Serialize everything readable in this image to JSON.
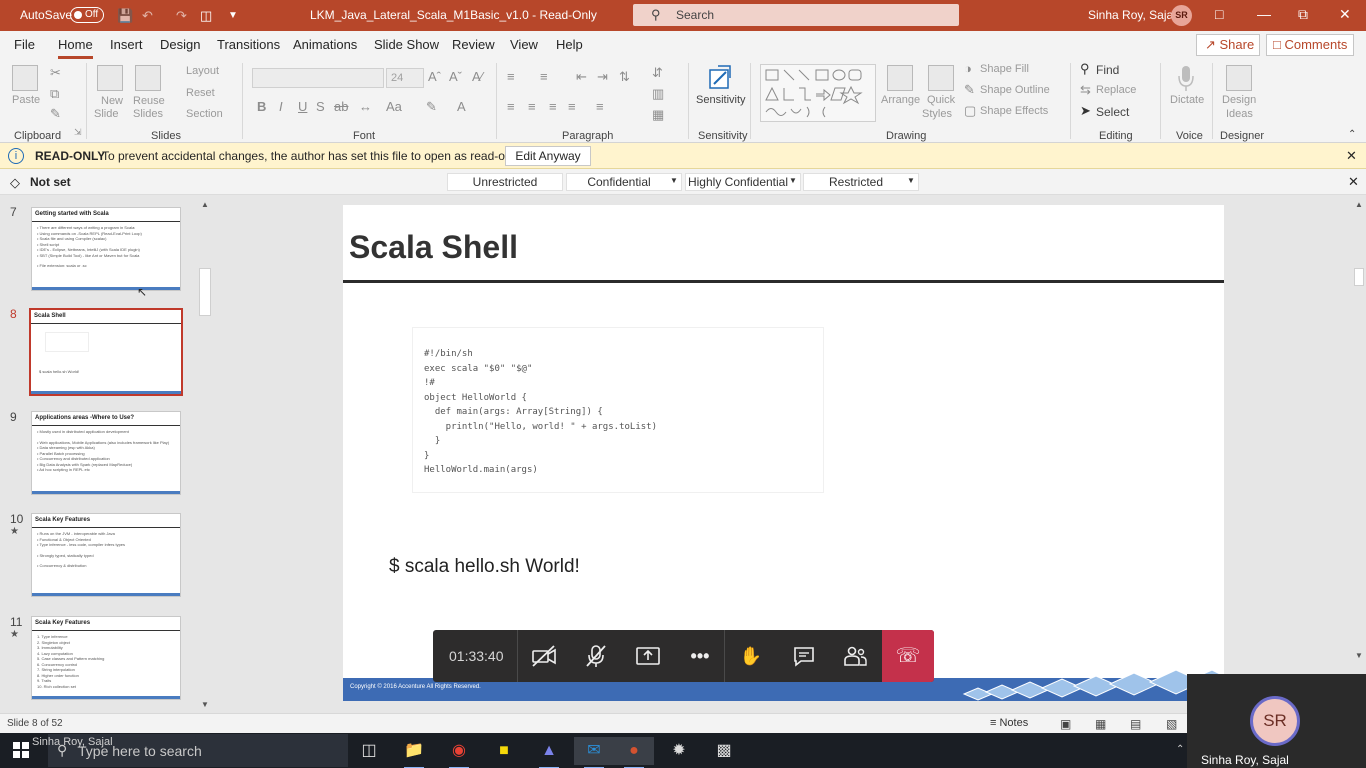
{
  "titlebar": {
    "autosave_label": "AutoSave",
    "autosave_state": "Off",
    "doc_title": "LKM_Java_Lateral_Scala_M1Basic_v1.0  -  Read-Only",
    "search_placeholder": "Search",
    "user_name": "Sinha Roy, Sajal",
    "user_initials": "SR",
    "accent_color": "#b7472a"
  },
  "menu": {
    "tabs": [
      "File",
      "Home",
      "Insert",
      "Design",
      "Transitions",
      "Animations",
      "Slide Show",
      "Review",
      "View",
      "Help"
    ],
    "active_tab": "Home",
    "share_label": "Share",
    "comments_label": "Comments"
  },
  "ribbon": {
    "clipboard": {
      "label": "Clipboard",
      "paste": "Paste"
    },
    "slides": {
      "label": "Slides",
      "new_slide_1": "New",
      "new_slide_2": "Slide",
      "reuse_1": "Reuse",
      "reuse_2": "Slides",
      "layout": "Layout",
      "reset": "Reset",
      "section": "Section"
    },
    "font": {
      "label": "Font",
      "size": "24"
    },
    "paragraph": {
      "label": "Paragraph"
    },
    "sensitivity": {
      "label": "Sensitivity",
      "button": "Sensitivity"
    },
    "drawing": {
      "label": "Drawing",
      "arrange": "Arrange",
      "quick_1": "Quick",
      "quick_2": "Styles",
      "fill": "Shape Fill",
      "outline": "Shape Outline",
      "effects": "Shape Effects"
    },
    "editing": {
      "label": "Editing",
      "find": "Find",
      "replace": "Replace",
      "select": "Select"
    },
    "voice": {
      "label": "Voice",
      "dictate": "Dictate"
    },
    "designer": {
      "label": "Designer",
      "ideas_1": "Design",
      "ideas_2": "Ideas"
    }
  },
  "readonly_bar": {
    "label": "READ-ONLY",
    "message": "To prevent accidental changes, the author has set this file to open as read-only.",
    "button": "Edit Anyway"
  },
  "sensitivity_bar": {
    "status": "Not set",
    "levels": [
      "Unrestricted",
      "Confidential",
      "Highly Confidential",
      "Restricted"
    ]
  },
  "thumbnails": [
    {
      "number": "7",
      "title": "Getting started with Scala",
      "lines": [
        "• There are different ways of writing a program in Scala:",
        "  • Using commands on -Scala REPL (Read-Eval-Print Loop)",
        "  • Scala file and using Compiler (scalac)",
        "  • Shell script",
        "  • IDE's - Eclipse, Netbeans, IntelliJ (with Scala IDE plugin)",
        "  • SBT (Simple Build Tool) - like Ant or Maven but for Scala",
        "",
        "• File extension: scala or .sc"
      ],
      "starred": false,
      "selected": false
    },
    {
      "number": "8",
      "title": "Scala Shell",
      "lines": [],
      "sub": "$ scala hello.sh World!",
      "starred": false,
      "selected": true
    },
    {
      "number": "9",
      "title": "Applications areas -Where to Use?",
      "lines": [
        "• Mostly used in distributed application development",
        "",
        "• Web applications, Mobile Applications (also includes framework like Play)",
        "• Data streaming (esp with Akka)",
        "• Parallel Batch processing",
        "• Concurrency and distributed application",
        "• Big Data Analysis with Spark (replaced MapReduce)",
        "• Ad hoc scripting in REPL etc"
      ],
      "starred": false,
      "selected": false
    },
    {
      "number": "10",
      "title": "Scala Key Features",
      "lines": [
        "• Runs on the JVM - interoperable with Java",
        "• Functional & Object Oriented",
        "• Type inference - less code, compiler infers types",
        "",
        "• Strongly typed, statically typed",
        "",
        "• Concurrency & distribution"
      ],
      "starred": true,
      "selected": false
    },
    {
      "number": "11",
      "title": "Scala Key Features",
      "lines": [
        "1. Type inference",
        "2. Singleton object",
        "3. Immutability",
        "4. Lazy computation",
        "5. Case classes and Pattern matching",
        "6. Concurrency control",
        "7. String interpolation",
        "8. Higher order function",
        "9. Traits",
        "10. Rich collection set"
      ],
      "starred": true,
      "selected": false
    }
  ],
  "slide": {
    "title": "Scala Shell",
    "code": "#!/bin/sh\nexec scala \"$0\" \"$@\"\n!#\nobject HelloWorld {\n  def main(args: Array[String]) {\n    println(\"Hello, world! \" + args.toList)\n  }\n}\nHelloWorld.main(args)",
    "command": "$ scala hello.sh World!",
    "copyright": "Copyright © 2016 Accenture All Rights Reserved."
  },
  "callbar": {
    "duration": "01:33:40"
  },
  "statusbar": {
    "slide_info": "Slide 8 of 52",
    "notes": "Notes"
  },
  "taskbar": {
    "search_placeholder": "Type here to search",
    "ghost_name": "Sinha Roy, Sajal"
  },
  "videotile": {
    "initials": "SR",
    "name": "Sinha Roy, Sajal"
  }
}
